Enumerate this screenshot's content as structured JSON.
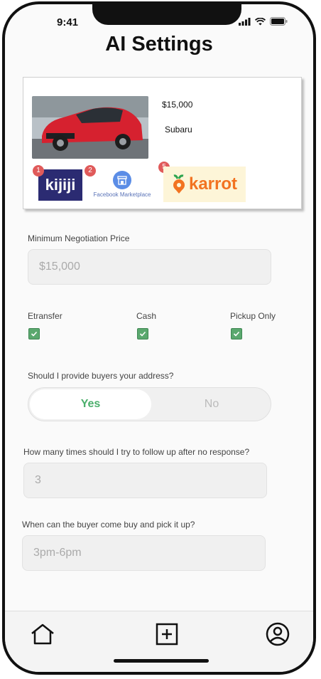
{
  "status": {
    "time": "9:41"
  },
  "header": {
    "title": "AI Settings"
  },
  "listing": {
    "price": "$15,000",
    "make": "Subaru",
    "marketplaces": [
      {
        "name": "kijiji",
        "logo_text": "kijiji",
        "badge": "1"
      },
      {
        "name": "facebook-marketplace",
        "logo_text": "Facebook Marketplace",
        "badge": "2"
      },
      {
        "name": "karrot",
        "logo_text": "karrot",
        "badge": "5"
      }
    ]
  },
  "min_price": {
    "label": "Minimum Negotiation Price",
    "placeholder": "$15,000"
  },
  "payment_options": [
    {
      "label": "Etransfer",
      "checked": true
    },
    {
      "label": "Cash",
      "checked": true
    },
    {
      "label": "Pickup Only",
      "checked": true
    }
  ],
  "address_question": {
    "label": "Should I provide buyers your address?",
    "yes": "Yes",
    "no": "No",
    "selected": "Yes"
  },
  "follow_up": {
    "label": "How many times should I try to follow up after no response?",
    "placeholder": "3"
  },
  "pickup_time": {
    "label": "When can the buyer come buy and pick it up?",
    "placeholder": "3pm-6pm"
  },
  "nav": {
    "items": [
      "home-icon",
      "add-icon",
      "profile-icon"
    ]
  },
  "colors": {
    "accent_green": "#4caf6c",
    "badge_red": "#e05a5a",
    "kijiji_bg": "#2b2b72",
    "karrot_orange": "#f27321"
  }
}
